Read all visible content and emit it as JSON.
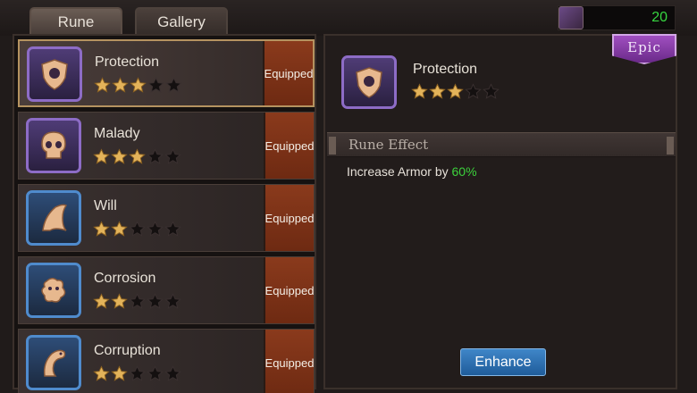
{
  "tabs": [
    {
      "label": "Rune",
      "active": true
    },
    {
      "label": "Gallery",
      "active": false
    }
  ],
  "currency": {
    "value": "20",
    "icon": "rune-currency-icon"
  },
  "runes": [
    {
      "name": "Protection",
      "stars": 3,
      "max_stars": 5,
      "status": "Equipped",
      "icon": "shield-icon",
      "frame": "purple",
      "selected": true
    },
    {
      "name": "Malady",
      "stars": 3,
      "max_stars": 5,
      "status": "Equipped",
      "icon": "skull-icon",
      "frame": "purple",
      "selected": false
    },
    {
      "name": "Will",
      "stars": 2,
      "max_stars": 5,
      "status": "Equipped",
      "icon": "wing-icon",
      "frame": "blue",
      "selected": false
    },
    {
      "name": "Corrosion",
      "stars": 2,
      "max_stars": 5,
      "status": "Equipped",
      "icon": "blob-icon",
      "frame": "blue",
      "selected": false
    },
    {
      "name": "Corruption",
      "stars": 2,
      "max_stars": 5,
      "status": "Equipped",
      "icon": "serpent-icon",
      "frame": "blue",
      "selected": false
    }
  ],
  "detail": {
    "rarity": "Epic",
    "name": "Protection",
    "stars": 3,
    "max_stars": 5,
    "effect_header": "Rune Effect",
    "effect_prefix": "Increase Armor by ",
    "effect_value": "60%",
    "enhance_label": "Enhance"
  },
  "colors": {
    "accent_green": "#3cd23c",
    "epic_purple": "#8d3fb0",
    "equipped_brown": "#7a3216",
    "button_blue": "#2b6fb0"
  }
}
